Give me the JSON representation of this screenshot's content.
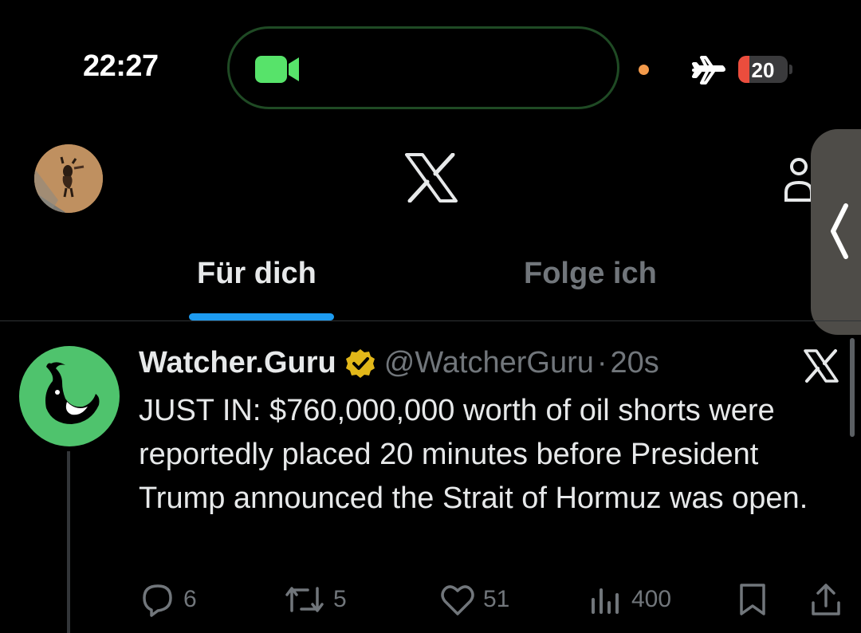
{
  "status_bar": {
    "time": "22:27",
    "battery_level": "20",
    "icons": [
      "camera-icon",
      "orange-dot-indicator",
      "airplane-icon",
      "battery-icon"
    ]
  },
  "header": {
    "logo": "X",
    "icons": [
      "profile-avatar",
      "x-logo-icon",
      "people-icon"
    ]
  },
  "tabs": [
    {
      "label": "Für dich",
      "active": true
    },
    {
      "label": "Folge ich",
      "active": false
    }
  ],
  "post": {
    "display_name": "Watcher.Guru",
    "handle": "@WatcherGuru",
    "separator": "·",
    "age": "20s",
    "text": "JUST IN: $760,000,000 worth of oil shorts were reportedly placed 20 minutes before President Trump announced the Strait of Hormuz was open.",
    "actions": {
      "replies": "6",
      "reposts": "5",
      "likes": "51",
      "views": "400"
    }
  },
  "colors": {
    "accent": "#1d9bf0",
    "muted": "#71767b",
    "avatar_green": "#4fc36d",
    "verified_gold": "#e2b719"
  }
}
